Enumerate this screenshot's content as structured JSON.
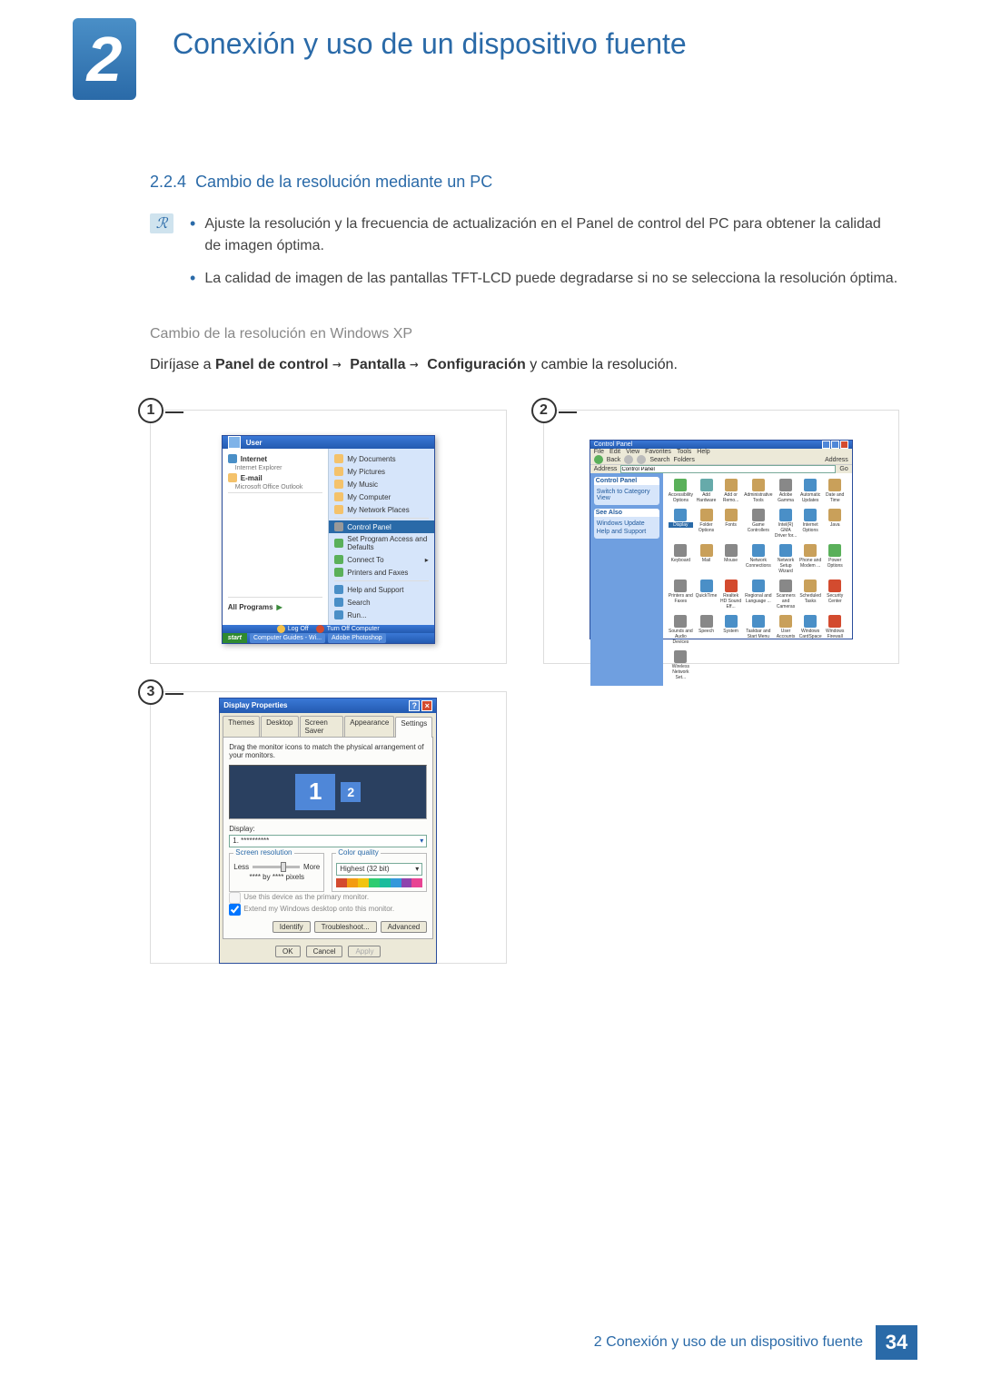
{
  "chapter": {
    "number": "2",
    "title": "Conexión y uso de un dispositivo fuente"
  },
  "section": {
    "number": "2.2.4",
    "title": "Cambio de la resolución mediante un PC"
  },
  "bullets": [
    "Ajuste la resolución y la frecuencia de actualización en el Panel de control del PC para obtener la calidad de imagen óptima.",
    "La calidad de imagen de las pantallas TFT-LCD puede degradarse si no se selecciona la resolución óptima."
  ],
  "sub_heading": "Cambio de la resolución en Windows XP",
  "instruction": {
    "lead": "Diríjase a ",
    "p1": "Panel de control",
    "p2": "Pantalla",
    "p3": "Configuración",
    "tail": " y cambie la resolución."
  },
  "fig_labels": {
    "1": "1",
    "2": "2",
    "3": "3"
  },
  "start_menu": {
    "user": "User",
    "left": {
      "internet": "Internet",
      "internet_sub": "Internet Explorer",
      "email": "E-mail",
      "email_sub": "Microsoft Office Outlook",
      "all_programs": "All Programs"
    },
    "right": [
      "My Documents",
      "My Pictures",
      "My Music",
      "My Computer",
      "My Network Places",
      "Control Panel",
      "Set Program Access and Defaults",
      "Connect To",
      "Printers and Faxes",
      "Help and Support",
      "Search",
      "Run..."
    ],
    "highlight_index": 5,
    "logoff": "Log Off",
    "turnoff": "Turn Off Computer",
    "taskbar": {
      "start": "start",
      "item1": "Computer Guides - Wi...",
      "item2": "Adobe Photoshop"
    }
  },
  "control_panel": {
    "title": "Control Panel",
    "menus": [
      "File",
      "Edit",
      "View",
      "Favorites",
      "Tools",
      "Help"
    ],
    "toolbar": {
      "back": "Back",
      "search": "Search",
      "folders": "Folders",
      "addr_label": "Address",
      "addr_value": "Control Panel",
      "go": "Go"
    },
    "side": {
      "box1_title": "Control Panel",
      "box1_link": "Switch to Category View",
      "box2_title": "See Also",
      "box2_links": [
        "Windows Update",
        "Help and Support"
      ]
    },
    "icons": [
      {
        "l": "Accessibility Options",
        "c": "#5ab05a"
      },
      {
        "l": "Add Hardware",
        "c": "#6aa"
      },
      {
        "l": "Add or Remo...",
        "c": "#c9a05a"
      },
      {
        "l": "Administrative Tools",
        "c": "#c9a05a"
      },
      {
        "l": "Adobe Gamma",
        "c": "#888"
      },
      {
        "l": "Automatic Updates",
        "c": "#4a8fc7"
      },
      {
        "l": "Date and Time",
        "c": "#c9a05a"
      },
      {
        "l": "Display",
        "c": "#4a8fc7",
        "sel": true
      },
      {
        "l": "Folder Options",
        "c": "#c9a05a"
      },
      {
        "l": "Fonts",
        "c": "#c9a05a"
      },
      {
        "l": "Game Controllers",
        "c": "#888"
      },
      {
        "l": "Intel(R) GMA Driver for...",
        "c": "#4a8fc7"
      },
      {
        "l": "Internet Options",
        "c": "#4a8fc7"
      },
      {
        "l": "Java",
        "c": "#c9a05a"
      },
      {
        "l": "Keyboard",
        "c": "#888"
      },
      {
        "l": "Mail",
        "c": "#c9a05a"
      },
      {
        "l": "Mouse",
        "c": "#888"
      },
      {
        "l": "Network Connections",
        "c": "#4a8fc7"
      },
      {
        "l": "Network Setup Wizard",
        "c": "#4a8fc7"
      },
      {
        "l": "Phone and Modem ...",
        "c": "#c9a05a"
      },
      {
        "l": "Power Options",
        "c": "#5ab05a"
      },
      {
        "l": "Printers and Faxes",
        "c": "#888"
      },
      {
        "l": "QuickTime",
        "c": "#4a8fc7"
      },
      {
        "l": "Realtek HD Sound Eff...",
        "c": "#d34b2f"
      },
      {
        "l": "Regional and Language ...",
        "c": "#4a8fc7"
      },
      {
        "l": "Scanners and Cameras",
        "c": "#888"
      },
      {
        "l": "Scheduled Tasks",
        "c": "#c9a05a"
      },
      {
        "l": "Security Center",
        "c": "#d34b2f"
      },
      {
        "l": "Sounds and Audio Devices",
        "c": "#888"
      },
      {
        "l": "Speech",
        "c": "#888"
      },
      {
        "l": "System",
        "c": "#4a8fc7"
      },
      {
        "l": "Taskbar and Start Menu",
        "c": "#4a8fc7"
      },
      {
        "l": "User Accounts",
        "c": "#c9a05a"
      },
      {
        "l": "Windows CardSpace",
        "c": "#4a8fc7"
      },
      {
        "l": "Windows Firewall",
        "c": "#d34b2f"
      },
      {
        "l": "Wireless Network Set...",
        "c": "#888"
      }
    ]
  },
  "display_props": {
    "title": "Display Properties",
    "tabs": [
      "Themes",
      "Desktop",
      "Screen Saver",
      "Appearance",
      "Settings"
    ],
    "active_tab": 4,
    "hint": "Drag the monitor icons to match the physical arrangement of your monitors.",
    "mon1": "1",
    "mon2": "2",
    "display_label": "Display:",
    "display_value": "1. **********",
    "res_group": "Screen resolution",
    "less": "Less",
    "more": "More",
    "px_line": "**** by **** pixels",
    "col_group": "Color quality",
    "col_value": "Highest (32 bit)",
    "colbar": [
      "#d34b2f",
      "#f39c12",
      "#f1c40f",
      "#2ecc71",
      "#1abc9c",
      "#3498db",
      "#8e44ad",
      "#e84393"
    ],
    "chk1": "Use this device as the primary monitor.",
    "chk2": "Extend my Windows desktop onto this monitor.",
    "btns_inner": [
      "Identify",
      "Troubleshoot...",
      "Advanced"
    ],
    "btns_outer": [
      "OK",
      "Cancel",
      "Apply"
    ]
  },
  "footer": {
    "text": "2 Conexión y uso de un dispositivo fuente",
    "page": "34"
  }
}
